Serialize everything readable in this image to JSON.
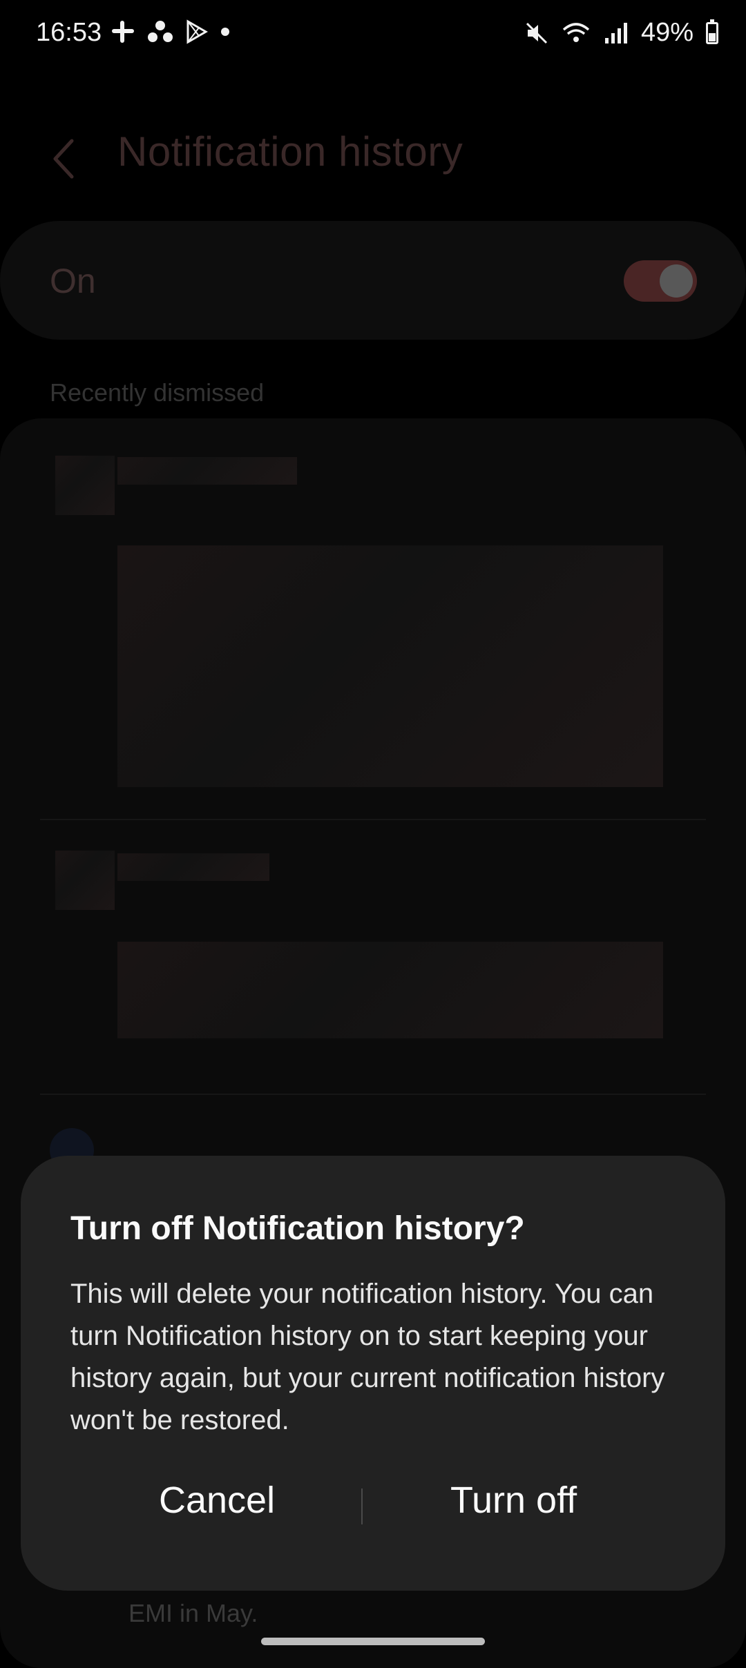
{
  "status_bar": {
    "time": "16:53",
    "battery": "49%",
    "icons": [
      "slack-icon",
      "dots-icon",
      "play-store-icon",
      "dot-icon",
      "mute-icon",
      "wifi-icon",
      "signal-icon",
      "battery-icon"
    ]
  },
  "page": {
    "title": "Notification history",
    "toggle_label": "On",
    "toggle_on": true,
    "section_label": "Recently dismissed",
    "faded_preview": "EMI in May."
  },
  "dialog": {
    "title": "Turn off Notification history?",
    "body": "This will delete your notification history. You can turn Notification history on to start keeping your history again, but your current notification history won't be restored.",
    "cancel_label": "Cancel",
    "confirm_label": "Turn off"
  },
  "colors": {
    "accent_toggle": "#4a2525",
    "dialog_bg": "#222222"
  }
}
